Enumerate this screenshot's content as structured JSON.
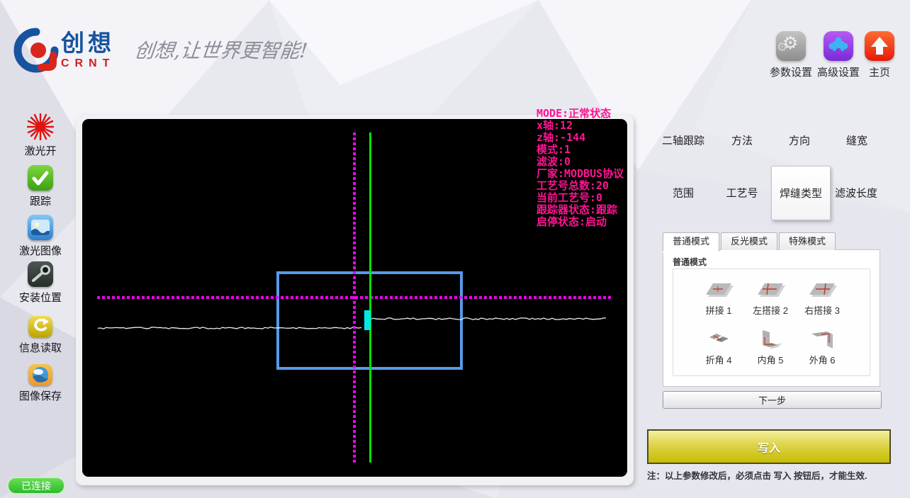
{
  "brand": {
    "name_cn": "创想",
    "name_en": "CRNT",
    "slogan": "创想,让世界更智能!",
    "logo_icon": "crnt-logo",
    "colors": {
      "brand_blue": "#17539f",
      "brand_red": "#ce1f1f"
    }
  },
  "header_actions": [
    {
      "label": "参数设置",
      "icon": "gear-icon"
    },
    {
      "label": "高级设置",
      "icon": "puzzle-icon"
    },
    {
      "label": "主页",
      "icon": "home-icon"
    }
  ],
  "sidebar": {
    "items": [
      {
        "label": "激光开",
        "icon": "laser-burst-icon"
      },
      {
        "label": "跟踪",
        "icon": "check-icon"
      },
      {
        "label": "激光图像",
        "icon": "laser-image-icon"
      },
      {
        "label": "安装位置",
        "icon": "install-position-icon"
      },
      {
        "label": "信息读取",
        "icon": "info-read-icon"
      },
      {
        "label": "图像保存",
        "icon": "image-save-icon"
      }
    ],
    "connection_status": "已连接",
    "connection_color": "#3ecb3e"
  },
  "canvas": {
    "status_lines": [
      "MODE:正常状态",
      "x轴:12",
      "z轴:-144",
      "模式:1",
      "滤波:0",
      "厂家:MODBUS协议",
      "工艺号总数:20",
      "当前工艺号:0",
      "跟踪器状态:跟踪",
      "启停状态:启动"
    ],
    "colors": {
      "status_text": "#ff1493",
      "crosshair": "#f400f4",
      "reference_line": "#00e300",
      "roi_box": "#579ae8",
      "laser_profile": "#eeeeee",
      "seam_marker": "#00e9e9",
      "background": "#000000"
    }
  },
  "settings_menu": {
    "rows": [
      [
        "二轴跟踪",
        "方法",
        "方向",
        "缝宽"
      ],
      [
        "范围",
        "工艺号",
        "焊缝类型",
        "滤波长度"
      ]
    ],
    "selected": "焊缝类型"
  },
  "tabs": [
    {
      "label": "普通模式",
      "active": true
    },
    {
      "label": "反光模式",
      "active": false
    },
    {
      "label": "特殊模式",
      "active": false
    }
  ],
  "weld_types": {
    "group_label": "普通模式",
    "options": [
      {
        "label": "拼接 1",
        "icon": "butt-joint-icon"
      },
      {
        "label": "左搭接 2",
        "icon": "left-lap-icon"
      },
      {
        "label": "右搭接 3",
        "icon": "right-lap-icon"
      },
      {
        "label": "折角 4",
        "icon": "fold-angle-icon"
      },
      {
        "label": "内角 5",
        "icon": "inner-corner-icon"
      },
      {
        "label": "外角 6",
        "icon": "outer-corner-icon"
      }
    ]
  },
  "actions": {
    "next_label": "下一步",
    "write_label": "写入",
    "write_color": "#c6bd00",
    "note": "注：以上参数修改后，必须点击 写入 按钮后，才能生效."
  }
}
